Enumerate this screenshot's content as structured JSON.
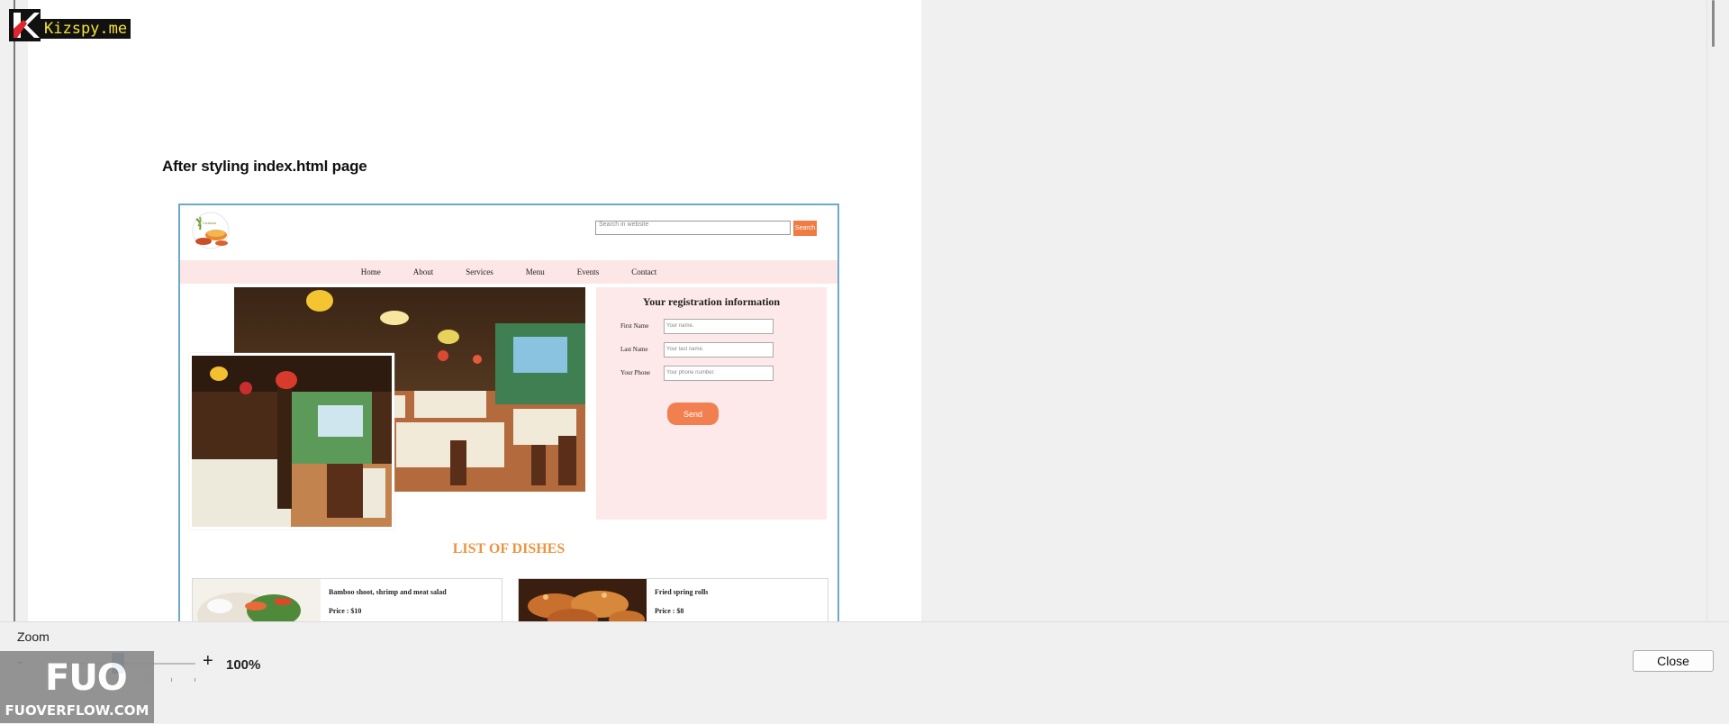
{
  "watermark_top": {
    "text": "Kizspy.me"
  },
  "document": {
    "heading": "After styling index.html page"
  },
  "website": {
    "search": {
      "placeholder": "Search in website",
      "button_label": "Search"
    },
    "nav": [
      "Home",
      "About",
      "Services",
      "Menu",
      "Events",
      "Contact"
    ],
    "form": {
      "title": "Your registration information",
      "fields": [
        {
          "label": "First Name",
          "placeholder": "Your name."
        },
        {
          "label": "Last Name",
          "placeholder": "Your last name."
        },
        {
          "label": "Your Phone",
          "placeholder": "Your phone number."
        }
      ],
      "send_label": "Send"
    },
    "dishes_title": "LIST OF DISHES",
    "dishes": [
      {
        "name": "Bamboo shoot, shrimp and meat salad",
        "price": "Price : $10"
      },
      {
        "name": "Fried spring rolls",
        "price": "Price : $8"
      }
    ]
  },
  "zoom": {
    "label": "Zoom",
    "minus": "-",
    "plus": "+",
    "value": "100%",
    "level_percent": 100
  },
  "close_label": "Close",
  "watermark_bottom": {
    "logo": "FUO",
    "text": "FUOVERFLOW.COM"
  },
  "colors": {
    "accent": "#ef7b45",
    "nav_bg": "#fde6e6",
    "dish_title": "#ec9441",
    "slider": "#1f5aa6"
  }
}
